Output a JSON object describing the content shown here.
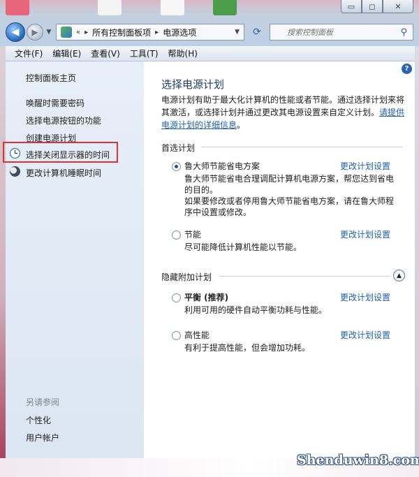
{
  "window": {
    "controls": {
      "minimize": "▭",
      "maximize": "◻",
      "close": "✕"
    }
  },
  "address_bar": {
    "overflow": "«",
    "crumbs": [
      "所有控制面板项",
      "电源选项"
    ],
    "separator": "▸"
  },
  "search": {
    "placeholder": "搜索控制面板"
  },
  "menu": [
    "文件(F)",
    "编辑(E)",
    "查看(V)",
    "工具(T)",
    "帮助(H)"
  ],
  "sidebar": {
    "home": "控制面板主页",
    "links": [
      "唤醒时需要密码",
      "选择电源按钮的功能",
      "创建电源计划",
      "选择关闭显示器的时间",
      "更改计算机睡眠时间"
    ],
    "see_also_title": "另请参阅",
    "see_also": [
      "个性化",
      "用户帐户"
    ],
    "highlight_color": "#e0312f"
  },
  "main": {
    "title": "选择电源计划",
    "description": "电源计划有助于最大化计算机的性能或者节能。通过选择计划来将其激活，或选择计划并通过更改其电源设置来自定义计划。",
    "description_link": "请提供电源计划的详细信息",
    "description_end": "。",
    "preferred_title": "首选计划",
    "hidden_title": "隐藏附加计划",
    "change_link": "更改计划设置",
    "plans_preferred": [
      {
        "name": "鲁大师节能省电方案",
        "desc_lines": [
          "鲁大师节能省电合理调配计算机电源方案，帮您达到省电的目的。",
          "如果要修改或者停用鲁大师节能省电方案，请在鲁大师程序中设置或修改。"
        ],
        "selected": true
      },
      {
        "name": "节能",
        "desc_lines": [
          "尽可能降低计算机性能以节能。"
        ],
        "selected": false
      }
    ],
    "plans_hidden": [
      {
        "name": "平衡 (推荐)",
        "desc_lines": [
          "利用可用的硬件自动平衡功耗与性能。"
        ],
        "selected": false
      },
      {
        "name": "高性能",
        "desc_lines": [
          "有利于提高性能，但会增加功耗。"
        ],
        "selected": false
      }
    ]
  },
  "watermark": "Shenduwin8.com",
  "colors": {
    "link": "#1c5fb5",
    "title": "#1d3a6b",
    "sidebar_bg": "#e7eef8"
  }
}
